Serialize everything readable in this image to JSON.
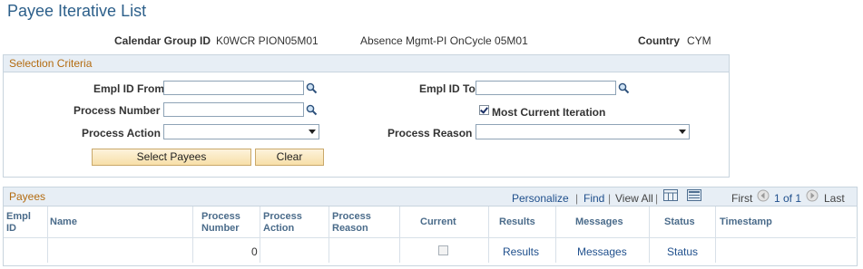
{
  "page": {
    "title": "Payee Iterative List"
  },
  "header": {
    "calendar_group_label": "Calendar Group ID",
    "calendar_group_value": "K0WCR PION05M01",
    "calendar_group_desc": "Absence Mgmt-PI OnCycle 05M01",
    "country_label": "Country",
    "country_value": "CYM"
  },
  "selection": {
    "title": "Selection Criteria",
    "empl_id_from_label": "Empl ID From",
    "empl_id_from_value": "",
    "empl_id_to_label": "Empl ID To",
    "empl_id_to_value": "",
    "process_number_label": "Process Number",
    "process_number_value": "",
    "most_current_label": "Most Current Iteration",
    "most_current_checked": true,
    "process_action_label": "Process Action",
    "process_action_value": "",
    "process_reason_label": "Process Reason",
    "process_reason_value": "",
    "select_payees_label": "Select Payees",
    "clear_label": "Clear"
  },
  "payees": {
    "title": "Payees",
    "personalize": "Personalize",
    "find": "Find",
    "sep1": "|",
    "sep2": "|",
    "view_all": "View All",
    "first": "First",
    "range": "1 of 1",
    "last": "Last",
    "columns": {
      "empl_id_line1": "Empl",
      "empl_id_line2": "ID",
      "name": "Name",
      "process_number_line1": "Process",
      "process_number_line2": "Number",
      "process_action_line1": "Process",
      "process_action_line2": "Action",
      "process_reason_line1": "Process",
      "process_reason_line2": "Reason",
      "current": "Current",
      "results": "Results",
      "messages": "Messages",
      "status": "Status",
      "timestamp": "Timestamp"
    },
    "rows": [
      {
        "empl_id": "",
        "name": "",
        "process_number": "0",
        "process_action": "",
        "process_reason": "",
        "current": false,
        "results": "Results",
        "messages": "Messages",
        "status": "Status",
        "timestamp": ""
      }
    ]
  },
  "icons": {
    "lookup": "magnifier-icon",
    "download": "download-excel-icon",
    "zoom": "grid-zoom-icon",
    "prev": "arrow-left-icon",
    "next": "arrow-right-icon"
  },
  "colors": {
    "title": "#2c5f8a",
    "section_title": "#b36b10",
    "link": "#1f4f8c",
    "button_top": "#fdf3dc",
    "button_bottom": "#f7dfa8"
  }
}
